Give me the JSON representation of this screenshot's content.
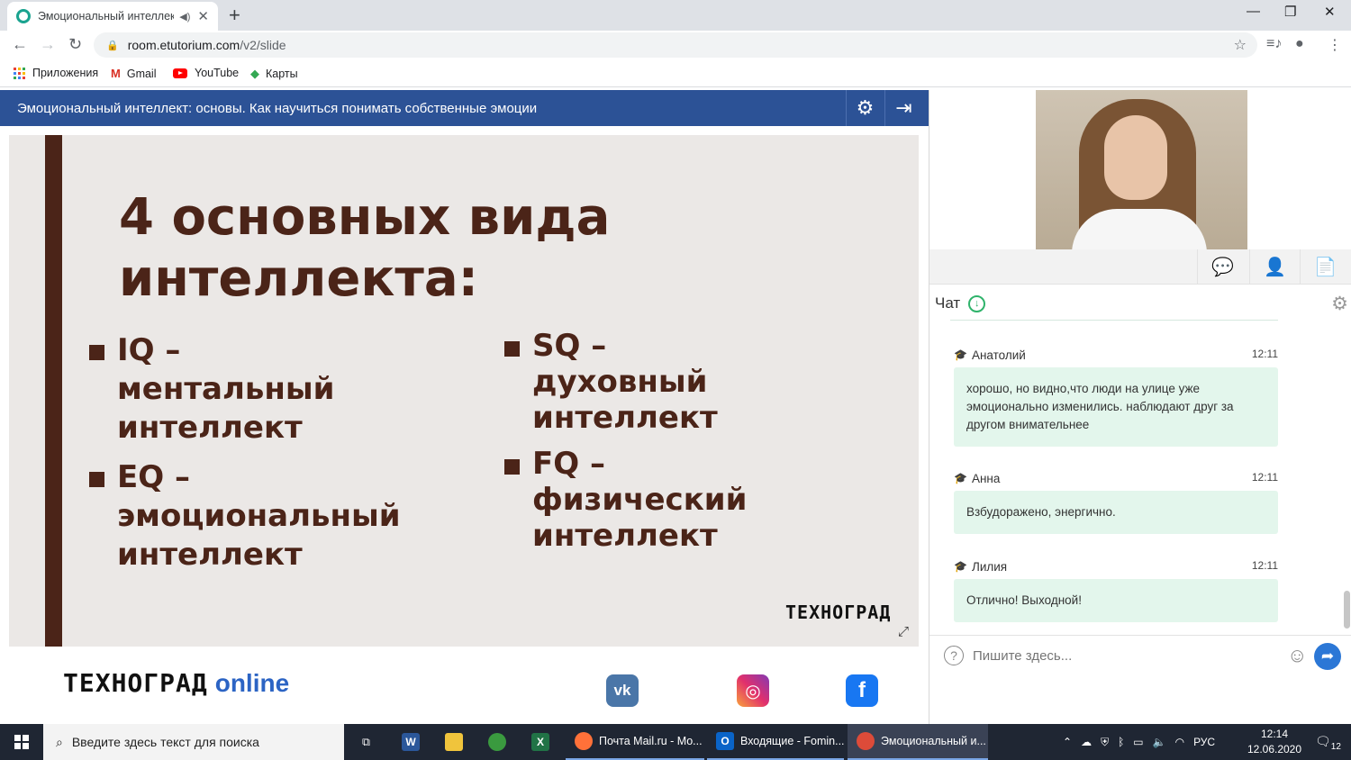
{
  "browser": {
    "tab_title": "Эмоциональный интеллект",
    "url_host": "room.etutorium.com",
    "url_path": "/v2/slide",
    "bookmarks": [
      "Приложения",
      "Gmail",
      "YouTube",
      "Карты"
    ]
  },
  "room": {
    "title": "Эмоциональный интеллект: основы. Как научиться понимать собственные эмоции"
  },
  "slide": {
    "heading_line1": "4 основных вида",
    "heading_line2": "интеллекта:",
    "bullets": [
      {
        "lines": [
          "IQ –",
          "ментальный",
          "интеллект"
        ]
      },
      {
        "lines": [
          "EQ –",
          "эмоциональный",
          "интеллект"
        ]
      },
      {
        "lines": [
          "SQ –",
          "духовный",
          "интеллект"
        ]
      },
      {
        "lines": [
          "FQ –",
          "физический",
          "интеллект"
        ]
      }
    ],
    "brand": "ТЕХНОГРАД"
  },
  "footer": {
    "brand": "ТЕХНОГРАД",
    "brand_suffix": "online",
    "social": [
      "vk-icon",
      "instagram-icon",
      "facebook-icon"
    ]
  },
  "chat": {
    "title": "Чат",
    "messages": [
      {
        "author": "Анатолий",
        "time": "12:11",
        "text": "хорошо, но видно,что люди на улице уже эмоционально изменились. наблюдают друг за другом внимательнее"
      },
      {
        "author": "Анна",
        "time": "12:11",
        "text": "Взбудоражено, энергично."
      },
      {
        "author": "Лилия",
        "time": "12:11",
        "text": "Отлично! Выходной!"
      }
    ],
    "input_placeholder": "Пишите здесь..."
  },
  "taskbar": {
    "search_placeholder": "Введите здесь текст для поиска",
    "apps": [
      {
        "label": "Почта Mail.ru - Mo...",
        "icon": "firefox-icon"
      },
      {
        "label": "Входящие - Fomin...",
        "icon": "outlook-icon"
      },
      {
        "label": "Эмоциональный и...",
        "icon": "chrome-icon"
      }
    ],
    "language": "РУС",
    "time": "12:14",
    "date": "12.06.2020",
    "notifications": "12"
  },
  "colors": {
    "header_blue": "#2c5296",
    "slide_brown": "#4b2418",
    "chat_bubble": "#e3f6ec",
    "send_blue": "#2b77d6"
  }
}
